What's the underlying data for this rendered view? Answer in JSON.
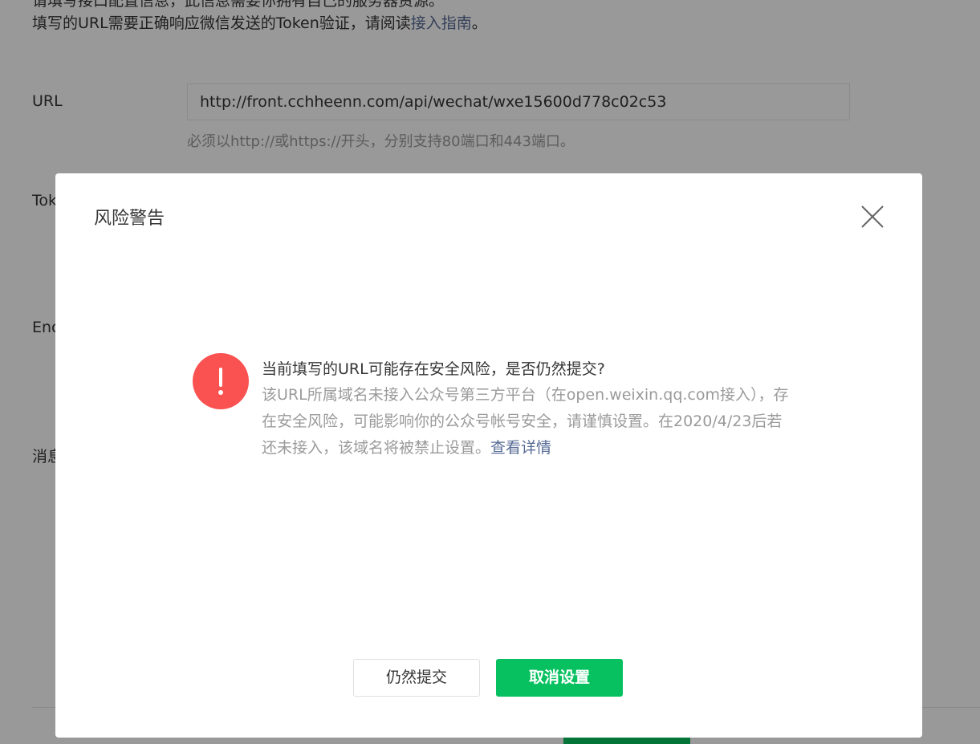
{
  "background": {
    "intro_cut_text": "请填写接口配置信息，此信息需要你拥有自己的服务器资源。",
    "intro_text_prefix": "填写的URL需要正确响应微信发送的Token验证，请阅读",
    "intro_link": "接入指南",
    "intro_text_suffix": "。",
    "url_label": "URL",
    "url_value": "http://front.cchheenn.com/api/wechat/wxe15600d778c02c53",
    "url_tip": "必须以http://或https://开头，分别支持80端口和443端口。",
    "token_label_partial": "Tok",
    "encoding_label_partial": "Enc",
    "message_label_partial": "消息"
  },
  "dialog": {
    "title": "风险警告",
    "close_icon": "close-icon",
    "warning_icon": "exclamation-circle-icon",
    "message_main": "当前填写的URL可能存在安全风险，是否仍然提交?",
    "message_desc": "该URL所属域名未接入公众号第三方平台（在open.weixin.qq.com接入），存在安全风险，可能影响你的公众号帐号安全，请谨慎设置。在2020/4/23后若还未接入，该域名将被禁止设置。",
    "message_link": "查看详情",
    "submit_anyway_label": "仍然提交",
    "cancel_setting_label": "取消设置"
  },
  "colors": {
    "primary_green": "#07c160",
    "warning_red": "#fa5151",
    "link_blue": "#576b95"
  }
}
